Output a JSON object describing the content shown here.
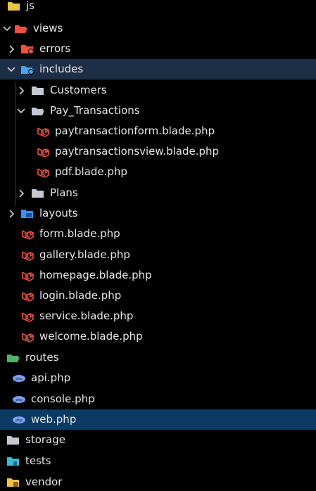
{
  "explorer": {
    "rows": [
      {
        "label": "js",
        "icon": "folder-js-icon"
      },
      {
        "label": "views",
        "icon": "folder-views-open-icon"
      },
      {
        "label": "errors",
        "icon": "folder-errors-icon"
      },
      {
        "label": "includes",
        "icon": "folder-includes-open-icon"
      },
      {
        "label": "Customers",
        "icon": "folder-icon"
      },
      {
        "label": "Pay_Transactions",
        "icon": "folder-open-icon"
      },
      {
        "label": "paytransactionform.blade.php",
        "icon": "laravel-icon"
      },
      {
        "label": "paytransactionsview.blade.php",
        "icon": "laravel-icon"
      },
      {
        "label": "pdf.blade.php",
        "icon": "laravel-icon"
      },
      {
        "label": "Plans",
        "icon": "folder-icon"
      },
      {
        "label": "layouts",
        "icon": "folder-layouts-icon"
      },
      {
        "label": "form.blade.php",
        "icon": "laravel-icon"
      },
      {
        "label": "gallery.blade.php",
        "icon": "laravel-icon"
      },
      {
        "label": "homepage.blade.php",
        "icon": "laravel-icon"
      },
      {
        "label": "login.blade.php",
        "icon": "laravel-icon"
      },
      {
        "label": "service.blade.php",
        "icon": "laravel-icon"
      },
      {
        "label": "welcome.blade.php",
        "icon": "laravel-icon"
      },
      {
        "label": "routes",
        "icon": "folder-routes-icon"
      },
      {
        "label": "api.php",
        "icon": "php-icon"
      },
      {
        "label": "console.php",
        "icon": "php-icon"
      },
      {
        "label": "web.php",
        "icon": "php-icon"
      },
      {
        "label": "storage",
        "icon": "folder-icon"
      },
      {
        "label": "tests",
        "icon": "folder-tests-icon"
      },
      {
        "label": "vendor",
        "icon": "folder-vendor-icon"
      }
    ]
  },
  "colors": {
    "background": "#000000",
    "text": "#e6e6e6",
    "active_row": "#1d2f47",
    "selected_row": "#0b3a63",
    "laravel_red": "#f0513f",
    "php_blue": "#7f9ff0",
    "folder_gray": "#c5c8d0"
  }
}
